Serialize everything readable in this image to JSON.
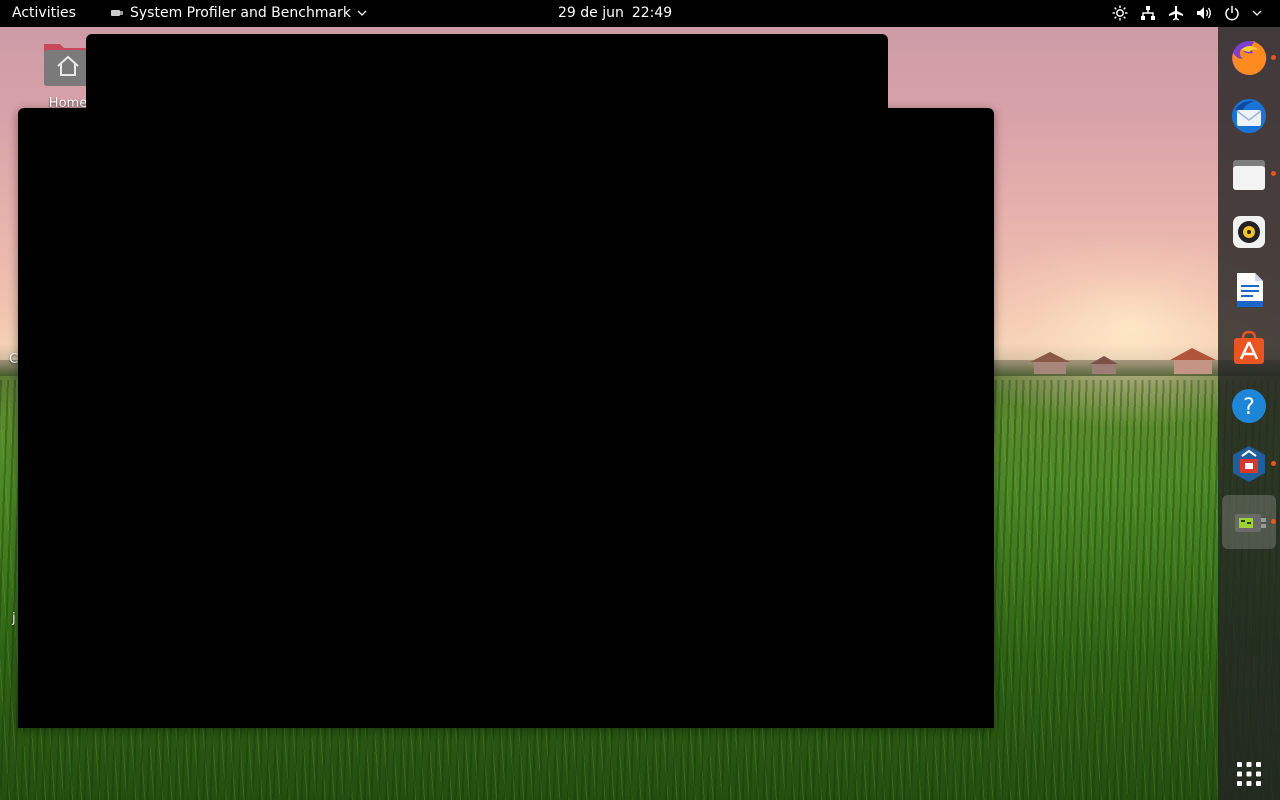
{
  "topbar": {
    "activities_label": "Activities",
    "app_name": "System Profiler and Benchmark",
    "date": "29 de jun",
    "time": "22:49",
    "tray_icons": [
      "brightness-icon",
      "network-icon",
      "airplane-mode-icon",
      "volume-icon",
      "power-icon",
      "chevron-down-icon"
    ]
  },
  "desktop": {
    "home_label": "Home",
    "edge_labels": [
      "C",
      "j"
    ]
  },
  "dock": {
    "items": [
      {
        "name": "firefox",
        "running": true
      },
      {
        "name": "thunderbird",
        "running": false
      },
      {
        "name": "files",
        "running": true
      },
      {
        "name": "rhythmbox",
        "running": false
      },
      {
        "name": "libreoffice-writer",
        "running": false
      },
      {
        "name": "ubuntu-software",
        "running": false
      },
      {
        "name": "help",
        "running": false
      },
      {
        "name": "app-installer",
        "running": true
      },
      {
        "name": "system-profiler",
        "running": true,
        "active": true
      }
    ],
    "show_apps": "show-applications-icon"
  },
  "colors": {
    "topbar_bg": "#000000",
    "dock_bg": "#232323",
    "running_dot": "#e95420",
    "window_bg": "#000000"
  }
}
